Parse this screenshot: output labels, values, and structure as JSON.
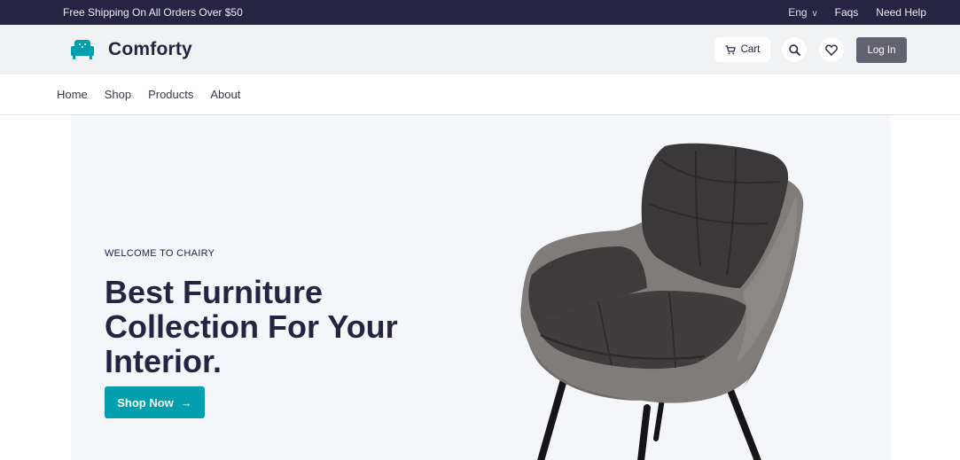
{
  "topbar": {
    "promo": "Free Shipping On All Orders Over $50",
    "language": "Eng",
    "faqs": "Faqs",
    "help": "Need Help"
  },
  "header": {
    "brand": "Comforty",
    "cart_label": "Cart",
    "login_label": "Log In",
    "icons": [
      "sofa-logo-icon",
      "cart-icon",
      "search-icon",
      "heart-icon"
    ]
  },
  "nav": {
    "items": [
      {
        "label": "Home"
      },
      {
        "label": "Shop"
      },
      {
        "label": "Products"
      },
      {
        "label": "About"
      }
    ]
  },
  "hero": {
    "eyebrow": "WELCOME TO CHAIRY",
    "headline": "Best Furniture Collection For Your Interior.",
    "cta": "Shop Now",
    "cta_arrow": "→"
  },
  "colors": {
    "topbar_bg": "#272343",
    "header_bg": "#f0f2f3",
    "accent": "#029fae",
    "login_bg": "#636270",
    "hero_bg": "#f5f6f9"
  }
}
